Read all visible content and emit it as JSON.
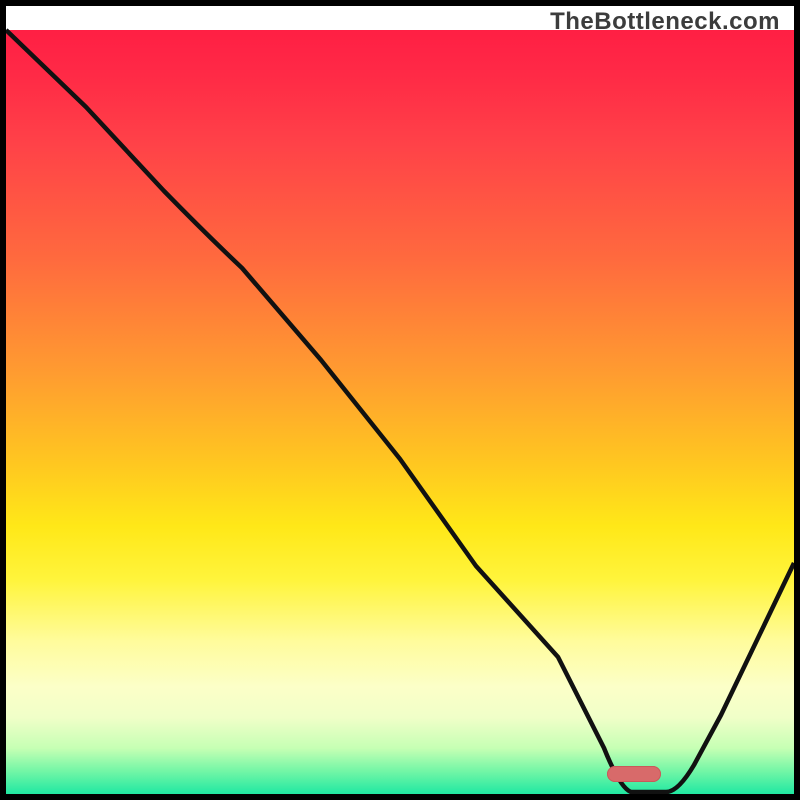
{
  "watermark": "TheBottleneck.com",
  "colors": {
    "frame": "#000000",
    "line": "#111111",
    "gradient_top": "#ff1f44",
    "gradient_mid": "#ffe818",
    "gradient_bottom": "#20e8a2",
    "pill": "#d86a6a"
  },
  "chart_data": {
    "type": "line",
    "title": "",
    "xlabel": "",
    "ylabel": "",
    "xlim": [
      0,
      100
    ],
    "ylim": [
      0,
      100
    ],
    "grid": false,
    "legend": false,
    "series": [
      {
        "name": "bottleneck-curve",
        "x": [
          0,
          10,
          20,
          30,
          40,
          50,
          60,
          70,
          76,
          80,
          84,
          90,
          100
        ],
        "y": [
          100,
          90,
          79,
          72,
          60,
          47,
          33,
          18,
          6,
          0,
          0,
          10,
          30
        ]
      }
    ],
    "annotations": [
      {
        "name": "optimal-range-pill",
        "x_start": 77,
        "x_end": 84,
        "y": 0
      }
    ]
  }
}
